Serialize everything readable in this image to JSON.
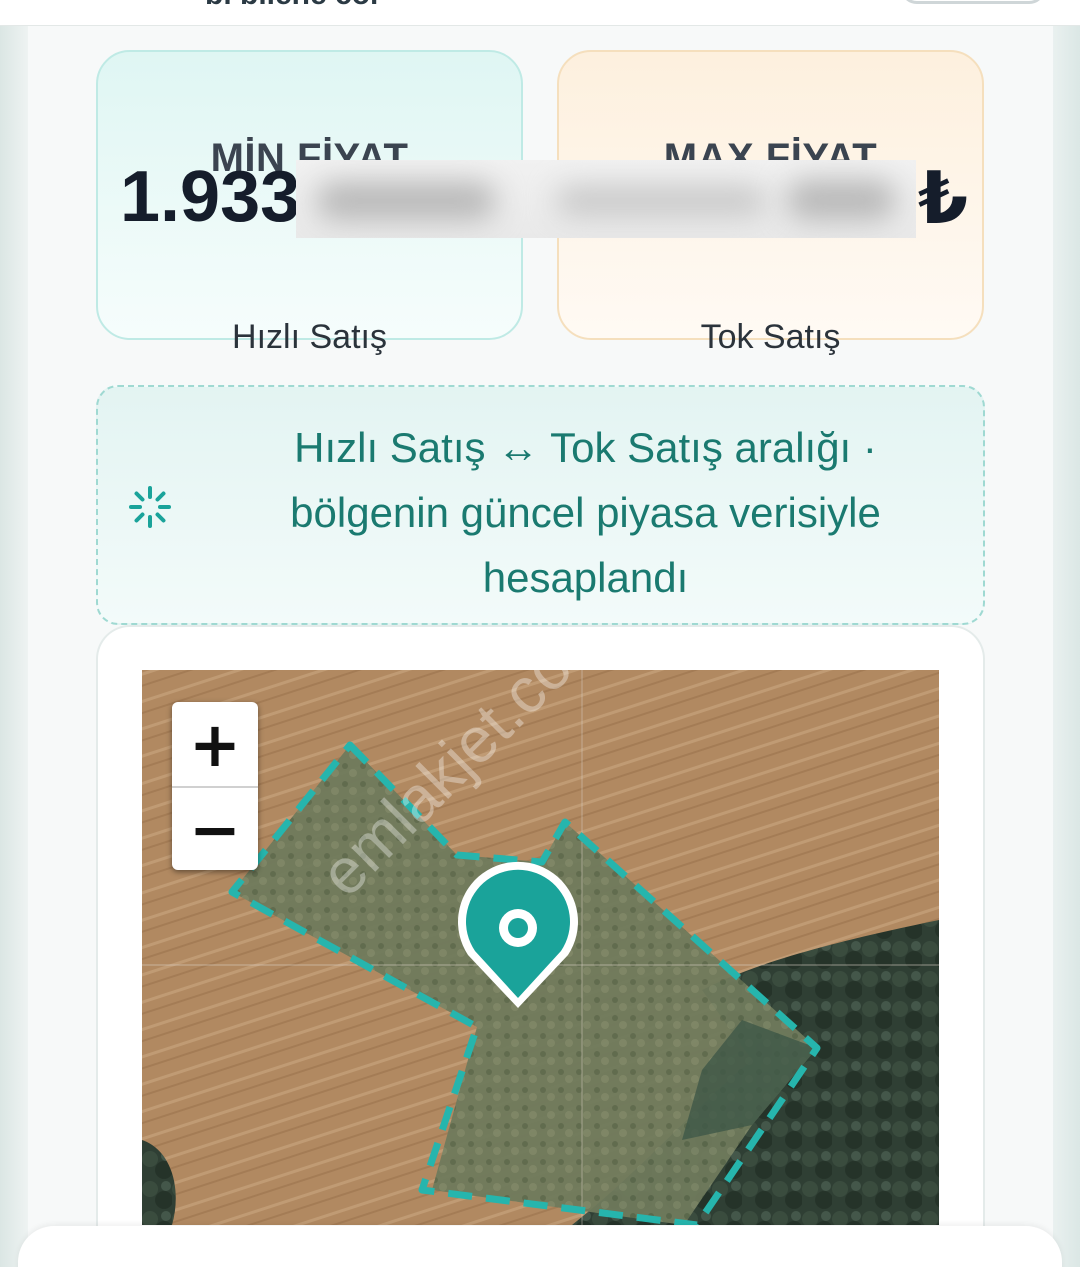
{
  "header": {
    "cut_text": "bi bilene cor"
  },
  "prices": {
    "min": {
      "title": "MİN FİYAT",
      "value_visible": "1.933",
      "subtitle": "Hızlı Satış"
    },
    "max": {
      "title": "MAX FİYAT",
      "currency_symbol": "₺",
      "subtitle": "Tok Satış"
    }
  },
  "info_banner": {
    "icon": "spinner-icon",
    "text": "Hızlı Satış ↔ Tok Satış aralığı · bölgenin güncel piyasa verisiyle hesaplandı"
  },
  "map": {
    "zoom_in": "+",
    "zoom_out": "−",
    "watermark": "emlakjet.com",
    "marker_color": "#1aa39a",
    "polygon_color": "#26b5ad"
  }
}
